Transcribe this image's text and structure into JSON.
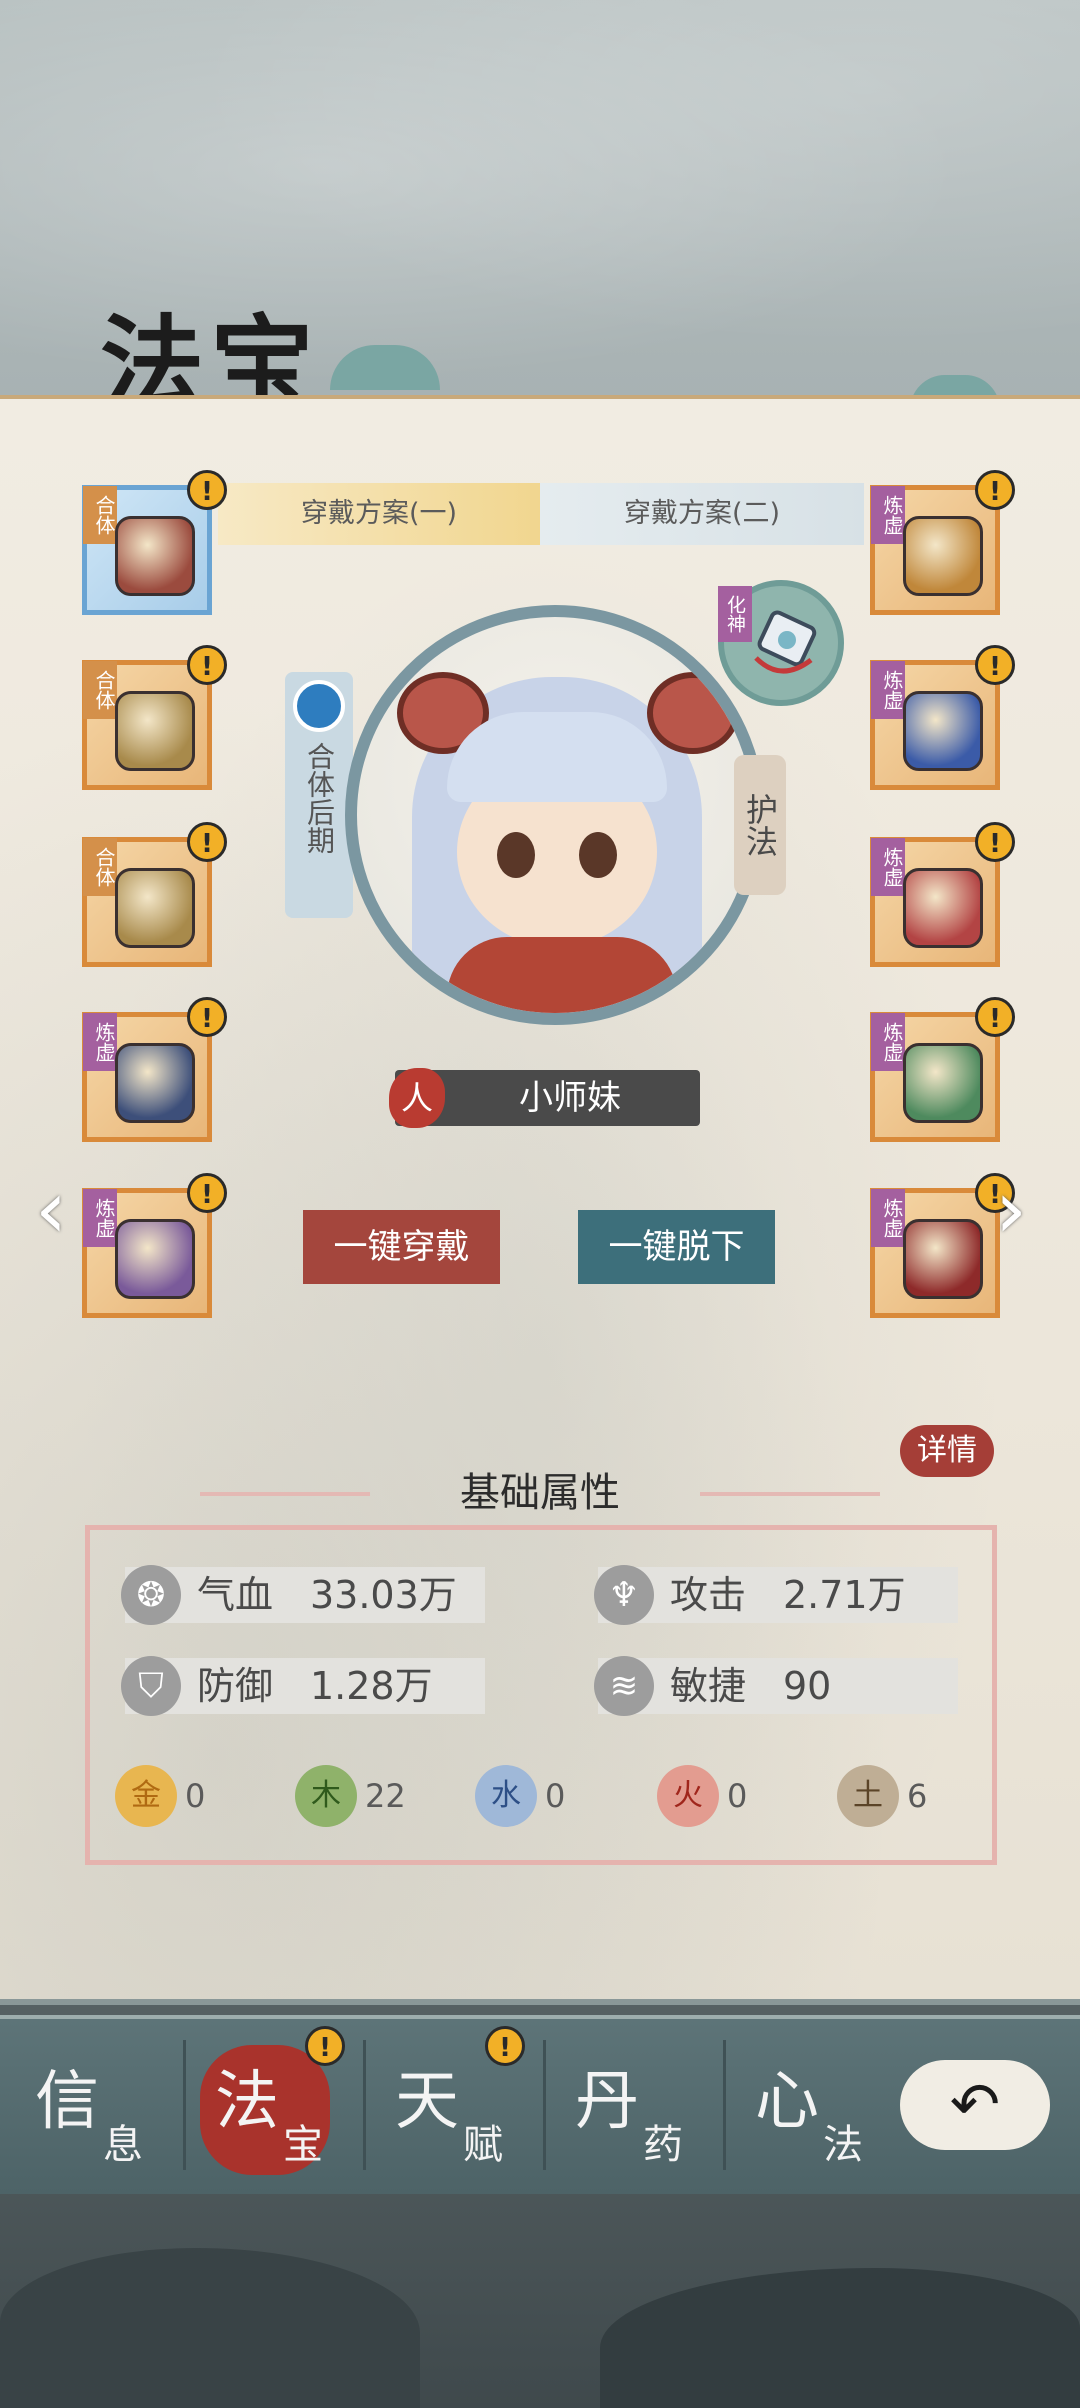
{
  "title": "法宝",
  "plans": {
    "plan1": "穿戴方案(一)",
    "plan2": "穿戴方案(二)"
  },
  "left_slots": [
    {
      "tag": "合体",
      "item": "crown",
      "color": "#9b4b3e",
      "alert": "!"
    },
    {
      "tag": "合体",
      "item": "beast-armor",
      "color": "#a88a4b",
      "alert": "!"
    },
    {
      "tag": "合体",
      "item": "beast-armor",
      "color": "#a88a4b",
      "alert": "!"
    },
    {
      "tag": "炼虚",
      "item": "armor",
      "color": "#3d4f7a",
      "alert": "!"
    },
    {
      "tag": "炼虚",
      "item": "boots",
      "color": "#7a5a9a",
      "alert": "!"
    }
  ],
  "right_slots": [
    {
      "tag": "炼虚",
      "item": "hairpin",
      "color": "#c0873a",
      "alert": "!"
    },
    {
      "tag": "炼虚",
      "item": "necklace",
      "color": "#3b5ba8",
      "alert": "!"
    },
    {
      "tag": "炼虚",
      "item": "gauntlet",
      "color": "#b34444",
      "alert": "!"
    },
    {
      "tag": "炼虚",
      "item": "belt",
      "color": "#4e8a5e",
      "alert": "!"
    },
    {
      "tag": "炼虚",
      "item": "ring",
      "color": "#8e2a2a",
      "alert": "!"
    }
  ],
  "character": {
    "realm": "合体后期",
    "race": "人",
    "name": "小师妹",
    "guard": "护法",
    "spirit_tag": "化神"
  },
  "buttons": {
    "equip_all": "一键穿戴",
    "unequip_all": "一键脱下",
    "prev": "‹",
    "next": "›"
  },
  "detail": "详情",
  "section_title": "基础属性",
  "stats": {
    "hp": {
      "label": "气血",
      "value": "33.03万"
    },
    "attack": {
      "label": "攻击",
      "value": "2.71万"
    },
    "defense": {
      "label": "防御",
      "value": "1.28万"
    },
    "agility": {
      "label": "敏捷",
      "value": "90"
    }
  },
  "elements": [
    {
      "glyph": "金",
      "value": "0",
      "color": "#e8b650",
      "text": "#b06a12"
    },
    {
      "glyph": "木",
      "value": "22",
      "color": "#8fb26a",
      "text": "#2f5a1c"
    },
    {
      "glyph": "水",
      "value": "0",
      "color": "#9fb8d8",
      "text": "#2d4f86"
    },
    {
      "glyph": "火",
      "value": "0",
      "color": "#e39c90",
      "text": "#a0261c"
    },
    {
      "glyph": "土",
      "value": "6",
      "color": "#bfae95",
      "text": "#5b4428"
    }
  ],
  "nav": [
    {
      "big": "信",
      "small": "息",
      "active": false,
      "alert": ""
    },
    {
      "big": "法",
      "small": "宝",
      "active": true,
      "alert": "!"
    },
    {
      "big": "天",
      "small": "赋",
      "active": false,
      "alert": "!"
    },
    {
      "big": "丹",
      "small": "药",
      "active": false,
      "alert": ""
    },
    {
      "big": "心",
      "small": "法",
      "active": false,
      "alert": ""
    }
  ],
  "back_icon": "↶"
}
